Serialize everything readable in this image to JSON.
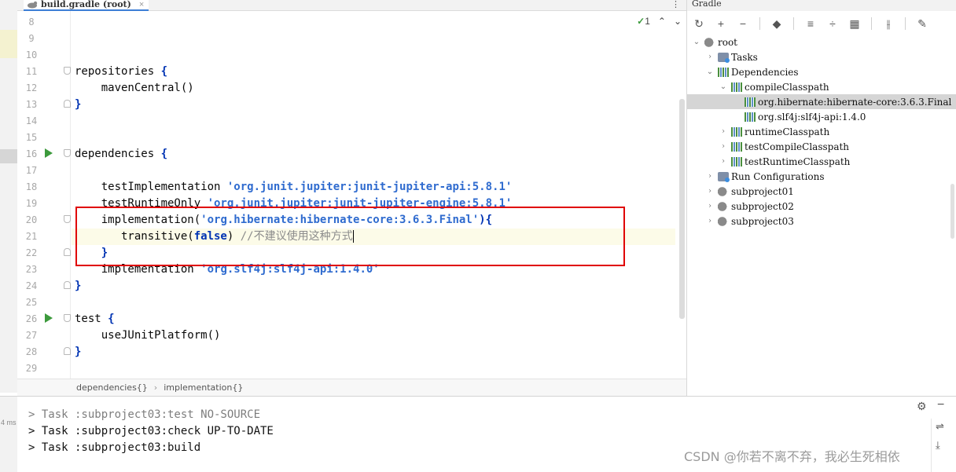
{
  "editor": {
    "tab_label": "build.gradle (root)",
    "tab_close": "×",
    "tab_more": "⋮",
    "inspection_count": "1",
    "line_numbers": [
      "8",
      "9",
      "10",
      "11",
      "12",
      "13",
      "14",
      "15",
      "16",
      "17",
      "18",
      "19",
      "20",
      "21",
      "22",
      "23",
      "24",
      "25",
      "26",
      "27",
      "28",
      "29"
    ],
    "code": {
      "l11_a": "repositories ",
      "l11_b": "{",
      "l12": "    mavenCentral()",
      "l13": "}",
      "l16_a": "dependencies ",
      "l16_b": "{",
      "l18_a": "    testImplementation ",
      "l18_b": "'org.junit.jupiter:junit-jupiter-api:5.8.1'",
      "l19_a": "    testRuntimeOnly ",
      "l19_b": "'org.junit.jupiter:junit-jupiter-engine:5.8.1'",
      "l20_a": "    implementation(",
      "l20_b": "'org.hibernate:hibernate-core:3.6.3.Final'",
      "l20_c": "){",
      "l21_a": "       transitive(",
      "l21_b": "false",
      "l21_c": ") ",
      "l21_d": "//不建议使用这种方式",
      "l22": "    }",
      "l23_a": "    implementation ",
      "l23_b": "'org.slf4j:slf4j-api:1.4.0'",
      "l24": "}",
      "l26_a": "test ",
      "l26_b": "{",
      "l27": "    useJUnitPlatform()",
      "l28": "}"
    }
  },
  "breadcrumb": {
    "items": [
      "dependencies{}",
      "implementation{}"
    ],
    "separator": "›"
  },
  "gradle": {
    "title": "Gradle",
    "tree": [
      {
        "label": "root",
        "arrow": "⌄"
      },
      {
        "label": "Tasks",
        "arrow": "›"
      },
      {
        "label": "Dependencies",
        "arrow": "⌄"
      },
      {
        "label": "compileClasspath",
        "arrow": "⌄"
      },
      {
        "label": "org.hibernate:hibernate-core:3.6.3.Final",
        "arrow": ""
      },
      {
        "label": "org.slf4j:slf4j-api:1.4.0",
        "arrow": ""
      },
      {
        "label": "runtimeClasspath",
        "arrow": "›"
      },
      {
        "label": "testCompileClasspath",
        "arrow": "›"
      },
      {
        "label": "testRuntimeClasspath",
        "arrow": "›"
      },
      {
        "label": "Run Configurations",
        "arrow": "›"
      },
      {
        "label": "subproject01",
        "arrow": "›"
      },
      {
        "label": "subproject02",
        "arrow": "›"
      },
      {
        "label": "subproject03",
        "arrow": "›"
      }
    ]
  },
  "console": {
    "time_label": "4 ms",
    "lines": [
      "> Task :subproject03:test NO-SOURCE",
      "> Task :subproject03:check UP-TO-DATE",
      "> Task :subproject03:build"
    ]
  },
  "watermark": "CSDN @你若不离不弃，我必生死相依",
  "colors": {
    "keyword": "#0033b3",
    "string": "#2f6bcf",
    "comment": "#8c8c8c",
    "highlight_box": "#e00000"
  }
}
